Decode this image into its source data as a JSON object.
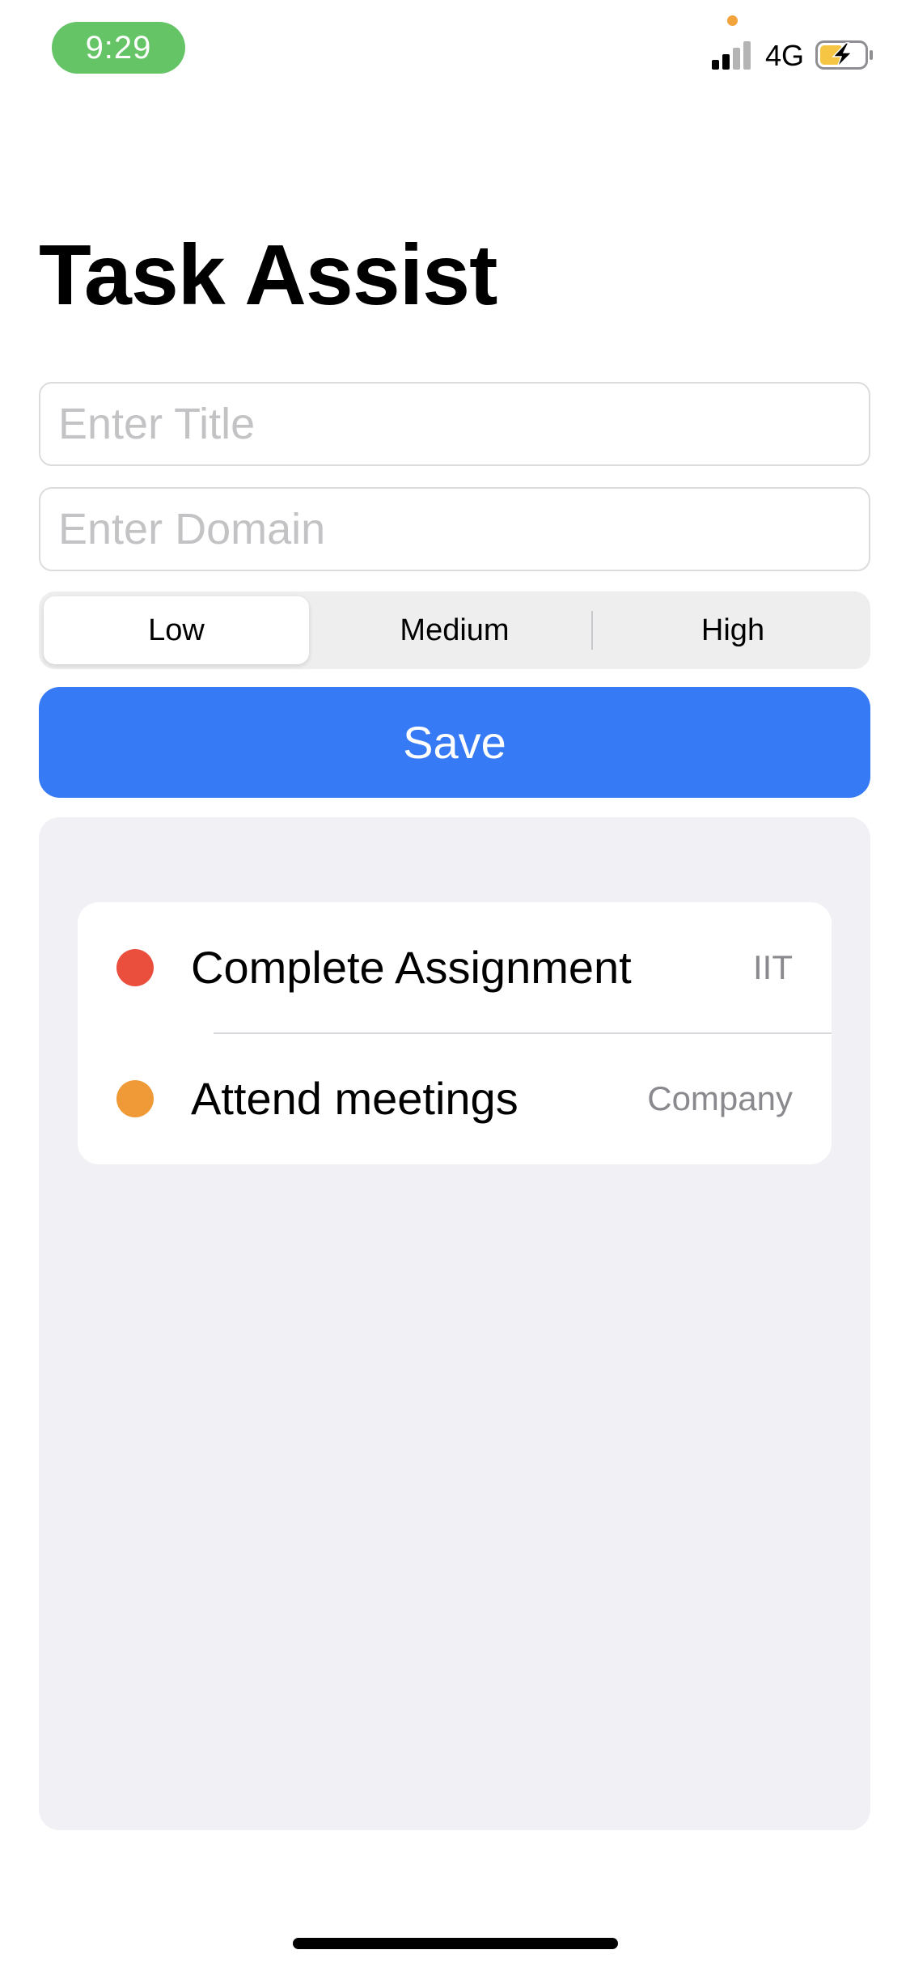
{
  "status_bar": {
    "time": "9:29",
    "network": "4G",
    "signal_bars_active": 2,
    "signal_bars_total": 4,
    "battery": "charging",
    "icons": [
      "signal-icon",
      "battery-charging-icon"
    ]
  },
  "page": {
    "title": "Task Assist"
  },
  "form": {
    "title_placeholder": "Enter Title",
    "title_value": "",
    "domain_placeholder": "Enter Domain",
    "domain_value": "",
    "priority_options": [
      "Low",
      "Medium",
      "High"
    ],
    "priority_selected": "Low",
    "save_label": "Save"
  },
  "tasks": [
    {
      "title": "Complete Assignment",
      "domain": "IIT",
      "color": "#ea4e3d"
    },
    {
      "title": "Attend meetings",
      "domain": "Company",
      "color": "#f09a37"
    }
  ],
  "colors": {
    "accent": "#377af5",
    "time_pill": "#65c466",
    "list_background": "#f0f0f5"
  }
}
